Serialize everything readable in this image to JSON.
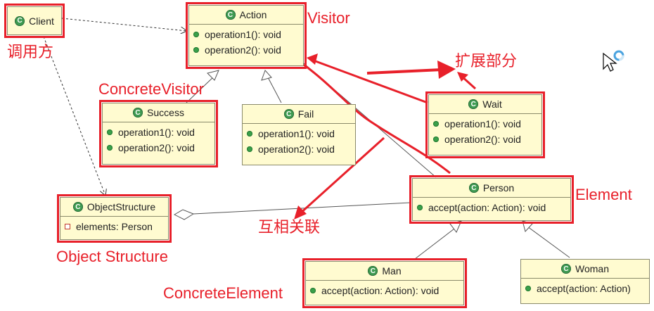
{
  "classes": {
    "client": {
      "name": "Client",
      "ops": []
    },
    "action": {
      "name": "Action",
      "ops": [
        "operation1(): void",
        "operation2(): void"
      ]
    },
    "success": {
      "name": "Success",
      "ops": [
        "operation1(): void",
        "operation2(): void"
      ]
    },
    "fail": {
      "name": "Fail",
      "ops": [
        "operation1(): void",
        "operation2(): void"
      ]
    },
    "wait": {
      "name": "Wait",
      "ops": [
        "operation1(): void",
        "operation2(): void"
      ]
    },
    "objectstructure": {
      "name": "ObjectStructure",
      "fields": [
        "elements: Person"
      ]
    },
    "person": {
      "name": "Person",
      "ops": [
        "accept(action: Action): void"
      ]
    },
    "man": {
      "name": "Man",
      "ops": [
        "accept(action: Action): void"
      ]
    },
    "woman": {
      "name": "Woman",
      "ops": [
        "accept(action: Action)"
      ]
    }
  },
  "labels": {
    "visitor": "Visitor",
    "caller": "调用方",
    "extension": "扩展部分",
    "concrete_visitor": "ConcreteVisitor",
    "element": "Element",
    "mutual": "互相关联",
    "object_structure": "Object Structure",
    "concrete_element": "ConcreteElement"
  },
  "colors": {
    "annotation": "#e8202a",
    "class_fill": "#fffbd0",
    "class_icon": "#3f9b52"
  }
}
